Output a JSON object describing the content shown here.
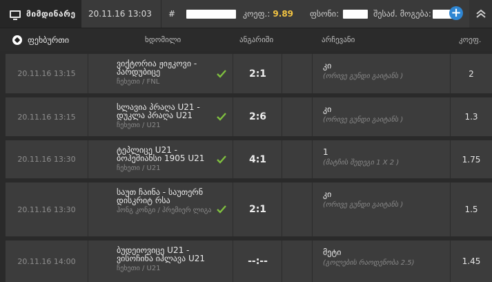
{
  "header": {
    "live_label": "მიმდინარე",
    "date": "20.11.16 13:03",
    "hash": "#",
    "coef_label": "კოეფ.:",
    "coef_value": "9.89",
    "amount_label": "ფსონი:",
    "win_label": "შესაძ. მოგება:",
    "plus": "+"
  },
  "columns": {
    "sport": "ფეხბურთი",
    "event": "ხდომილი",
    "score": "ანგარიში",
    "choice": "არჩევანი",
    "coef": "კოეფ."
  },
  "rows": [
    {
      "date": "20.11.16 13:15",
      "event": "ვიქტორია ჟიჟკოვი - პარდუბიცე",
      "league": "ჩეხეთი / FNL",
      "score": "2:1",
      "choice": "კი",
      "choice_sub": "(ორივე გუნდი გაიტანს )",
      "coef": "2",
      "won": true
    },
    {
      "date": "20.11.16 13:15",
      "event": "სლავია პრაღა U21 - დუკლა პრაღა U21",
      "league": "ჩეხეთი / U21",
      "score": "2:6",
      "choice": "კი",
      "choice_sub": "(ორივე გუნდი გაიტანს )",
      "coef": "1.3",
      "won": true
    },
    {
      "date": "20.11.16 13:30",
      "event": "ტეპლიცე U21 - ბოჰემიანსი 1905 U21",
      "league": "ჩეხეთი / U21",
      "score": "4:1",
      "choice": "1",
      "choice_sub": "(მატჩის შედეგი 1 X 2 )",
      "coef": "1.75",
      "won": true
    },
    {
      "date": "20.11.16 13:30",
      "event": "საუთ ჩაინა - საუთერნ დისკრიტ რსა",
      "league": "ჰონგ კონგი / პრემიერ ლიგა",
      "score": "2:1",
      "choice": "კი",
      "choice_sub": "(ორივე გუნდი გაიტანს )",
      "coef": "1.5",
      "won": true
    },
    {
      "date": "20.11.16 14:00",
      "event": "ბუდეიოვიცე U21 - ვისოჩინა იჰლავა U21",
      "league": "ჩეხეთი / U21",
      "score": "--:--",
      "choice": "მეტი",
      "choice_sub": "(გოლების რაოდენობა 2.5)",
      "coef": "1.45",
      "won": false
    }
  ]
}
